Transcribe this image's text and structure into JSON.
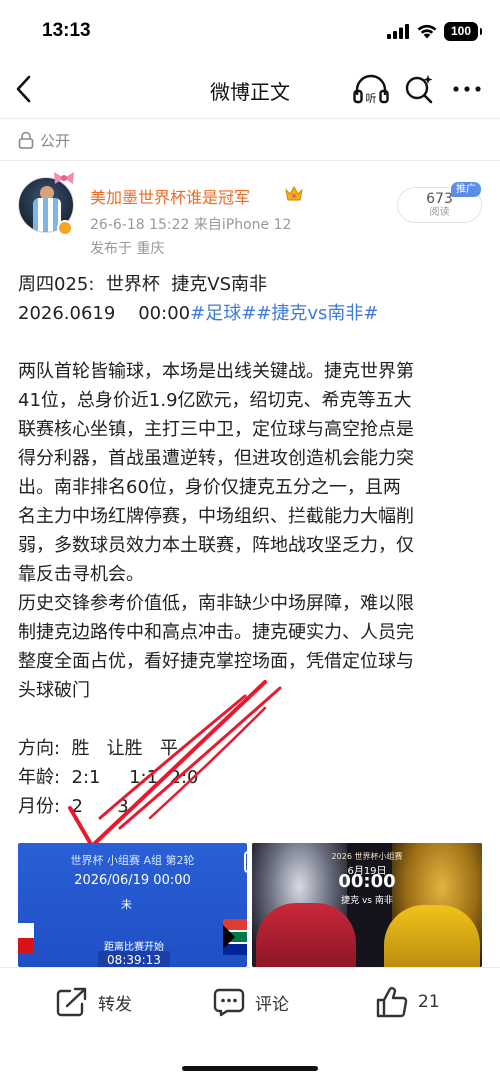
{
  "status_bar": {
    "time": "13:13",
    "battery": "100"
  },
  "nav": {
    "title": "微博正文"
  },
  "visibility": {
    "label": "公开"
  },
  "author": {
    "name": "美加墨世界杯谁是冠军",
    "meta": "26-6-18 15:22  来自iPhone 12",
    "location": "发布于 重庆"
  },
  "read": {
    "count": "673",
    "label": "阅读",
    "promo": "推广"
  },
  "post": {
    "line1": "周四025:  世界杯  捷克VS南非",
    "line2_prefix": "2026.0619    00:00",
    "topic1": "#足球#",
    "topic2": "#捷克vs南非#",
    "paragraph_lines": [
      "两队首轮皆输球，本场是出线关键战。捷克世界第",
      "41位，总身价近1.9亿欧元，绍切克、希克等五大",
      "联赛核心坐镇，主打三中卫，定位球与高空抢点是",
      "得分利器，首战虽遭逆转，但进攻创造机会能力突",
      "出。南非排名60位，身价仅捷克五分之一，且两",
      "名主力中场红牌停赛，中场组织、拦截能力大幅削",
      "弱，多数球员效力本土联赛，阵地战攻坚乏力，仅",
      "靠反击寻机会。",
      "历史交锋参考价值低，南非缺少中场屏障，难以限",
      "制捷克边路传中和高点冲击。捷克硬实力、人员完",
      "整度全面占优，看好捷克掌控场面，凭借定位球与",
      "头球破门"
    ],
    "pick_lines": [
      "方向:  胜   让胜   平",
      "年龄:  2:1     1:1  2:0",
      "月份:  2      3"
    ]
  },
  "image_left": {
    "title": "世界杯 小组赛 A组 第2轮",
    "date": "2026/06/19 00:00",
    "status": "未",
    "countdown_label": "距离比赛开始",
    "countdown": "08:39:13"
  },
  "image_right": {
    "header": "2026 世界杯小组赛",
    "date": "6月19日",
    "time": "00:00",
    "teams": "捷克 vs 南非"
  },
  "actions": {
    "repost": "转发",
    "comment": "评论",
    "like_count": "21"
  },
  "colors": {
    "accent_orange": "#f06a24",
    "topic_blue": "#3f7bd8",
    "handwriting_red": "#e8192c",
    "promo_blue": "#5b8ee6"
  }
}
